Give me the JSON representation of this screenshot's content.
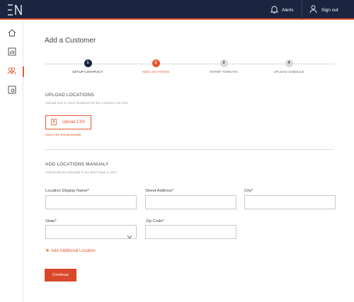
{
  "topbar": {
    "logo_text": "EN",
    "alerts_label": "Alerts",
    "signout_label": "Sign out",
    "accent": "#e4572e",
    "background": "#1b2540"
  },
  "sidebar": {
    "items": [
      {
        "icon": "home-icon",
        "active": false
      },
      {
        "icon": "analytics-icon",
        "active": false
      },
      {
        "icon": "customers-icon",
        "active": true
      },
      {
        "icon": "settings-icon",
        "active": false
      }
    ]
  },
  "page": {
    "title": "Add a Customer"
  },
  "stepper": {
    "steps": [
      {
        "number": "1",
        "label": "SETUP CONTRACT",
        "state": "complete"
      },
      {
        "number": "2",
        "label": "ADD LOCATIONS",
        "state": "active"
      },
      {
        "number": "3",
        "label": "ENTER THREATS",
        "state": "pending"
      },
      {
        "number": "4",
        "label": "UPLOAD SHEDULE",
        "state": "pending"
      }
    ]
  },
  "upload_section": {
    "title": "UPLOAD LOCATIONS",
    "subtitle": "Upload one or more locations for the customer via CSV",
    "button_label": "Upload CSV",
    "link_label": "View CSV format Details"
  },
  "manual_section": {
    "title": "ADD LOCATIONS MANUALY",
    "subtitle": "Add locations manually if you don't have a CSV",
    "fields": {
      "display_name": {
        "label": "Location Display Name*",
        "value": ""
      },
      "street": {
        "label": "Street Address*",
        "value": ""
      },
      "city": {
        "label": "City*",
        "value": ""
      },
      "state": {
        "label": "State*",
        "value": ""
      },
      "zip": {
        "label": "Zip Code*",
        "value": ""
      }
    },
    "add_label": "Add Additional Location"
  },
  "actions": {
    "continue_label": "Continue"
  }
}
